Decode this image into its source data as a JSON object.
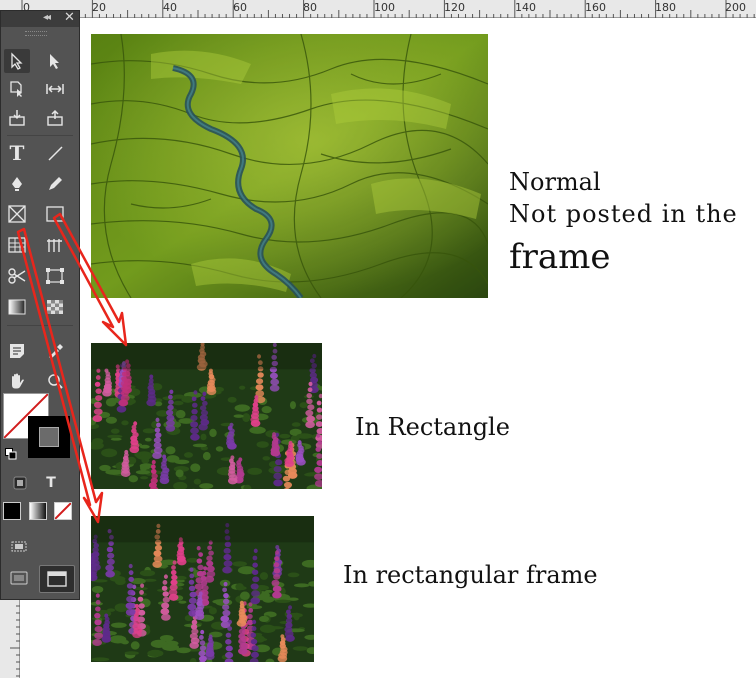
{
  "ruler": {
    "labels": [
      "0",
      "20",
      "40",
      "60",
      "80",
      "100",
      "120",
      "140",
      "160",
      "180",
      "200"
    ]
  },
  "toolbox": {
    "collapse_glyph": "◂◂",
    "close_glyph": "✕",
    "type_tool_glyph": "T",
    "text_formatting_glyph": "T",
    "tools": [
      "selection-tool",
      "direct-selection-tool",
      "page-tool",
      "gap-tool",
      "content-collector-tool",
      "content-placer-tool",
      "type-tool",
      "line-tool",
      "pen-tool",
      "pencil-tool",
      "rectangle-frame-tool",
      "rectangle-tool",
      "table-tool",
      "grid-tool",
      "scissors-tool",
      "free-transform-tool",
      "gradient-swatch-tool",
      "gradient-feather-tool",
      "note-tool",
      "eyedropper-tool",
      "hand-tool",
      "zoom-tool"
    ],
    "fill_color": "#ffffff",
    "stroke_color": "#000000",
    "active_tool": "selection-tool"
  },
  "captions": {
    "normal_line1": "Normal",
    "normal_line2": "Not posted in the",
    "normal_line3": "frame",
    "rectangle": "In Rectangle",
    "rect_frame": "In rectangular frame"
  },
  "colors": {
    "arrow": "#e8261c",
    "panel_bg": "#535353",
    "field_green": "#6f9a1c",
    "river": "#2f5f66",
    "lupine_pink": "#e0408a",
    "lupine_purple": "#7a3aa8"
  }
}
